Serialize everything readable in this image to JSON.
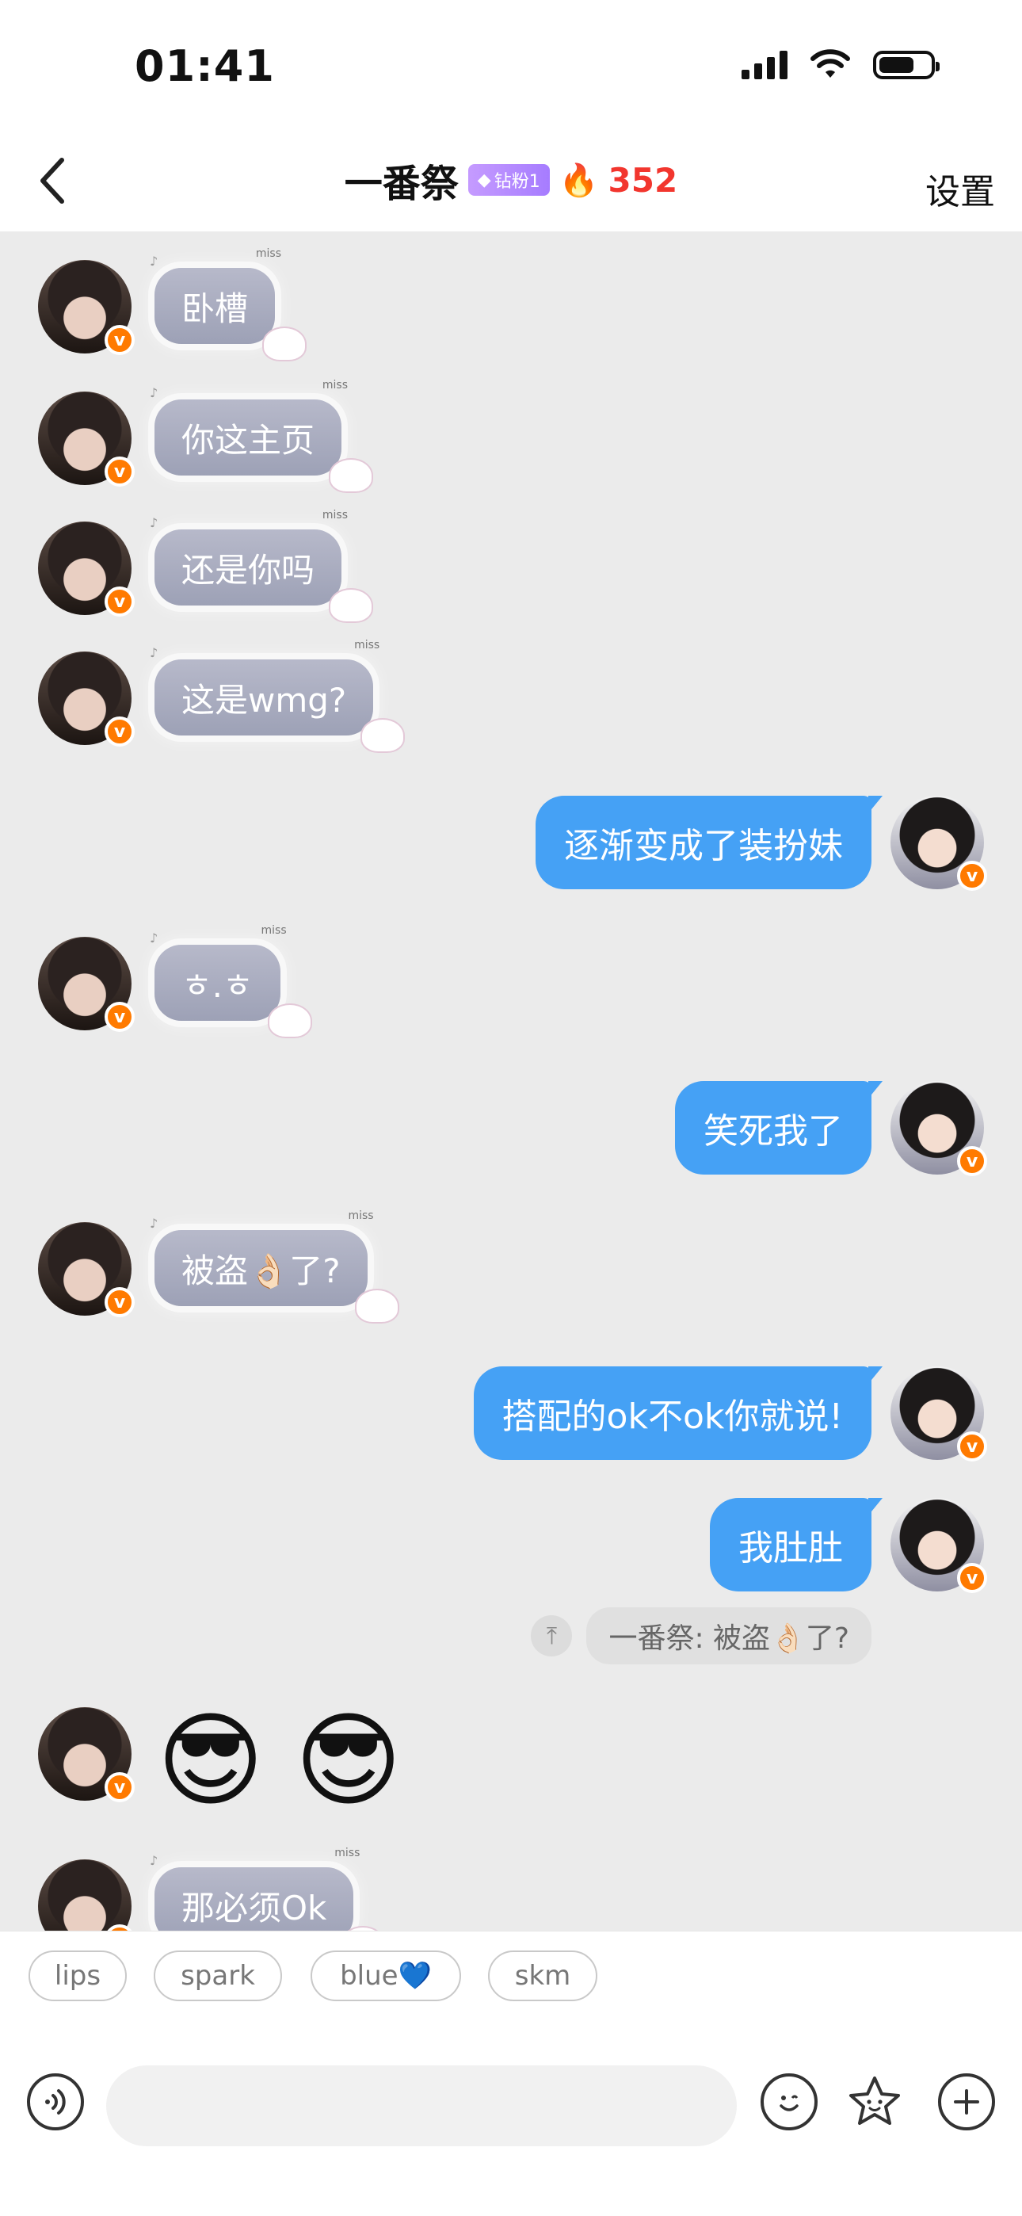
{
  "status_bar": {
    "time": "01:41"
  },
  "nav": {
    "title": "一番祭",
    "fan_badge": "钻粉1",
    "streak_count": "352",
    "settings_label": "设置"
  },
  "messages": [
    {
      "side": "left",
      "text": "卧槽"
    },
    {
      "side": "left",
      "text": "你这主页"
    },
    {
      "side": "left",
      "text": "还是你吗"
    },
    {
      "side": "left",
      "text": "这是wmg?"
    },
    {
      "side": "right",
      "text": "逐渐变成了装扮妹"
    },
    {
      "side": "left",
      "text": "ㅎ.ㅎ"
    },
    {
      "side": "right",
      "text": "笑死我了"
    },
    {
      "side": "left",
      "text": "被盗👌🏻了?"
    },
    {
      "side": "right",
      "text": "搭配的ok不ok你就说!"
    },
    {
      "side": "right",
      "text": "我肚肚"
    },
    {
      "side": "left",
      "text": "那必须Ok"
    }
  ],
  "quoted_reply": "一番祭: 被盗👌🏻了?",
  "emoji_message": "😎",
  "bubble_decoration": "miss",
  "avatar_badge": "v",
  "quick_replies": [
    "lips",
    "spark",
    "blue💙",
    "skm"
  ],
  "input": {
    "placeholder": ""
  },
  "colors": {
    "right_bubble": "#45a1f5",
    "streak": "#f2362e",
    "badge": "#ff7a00"
  }
}
